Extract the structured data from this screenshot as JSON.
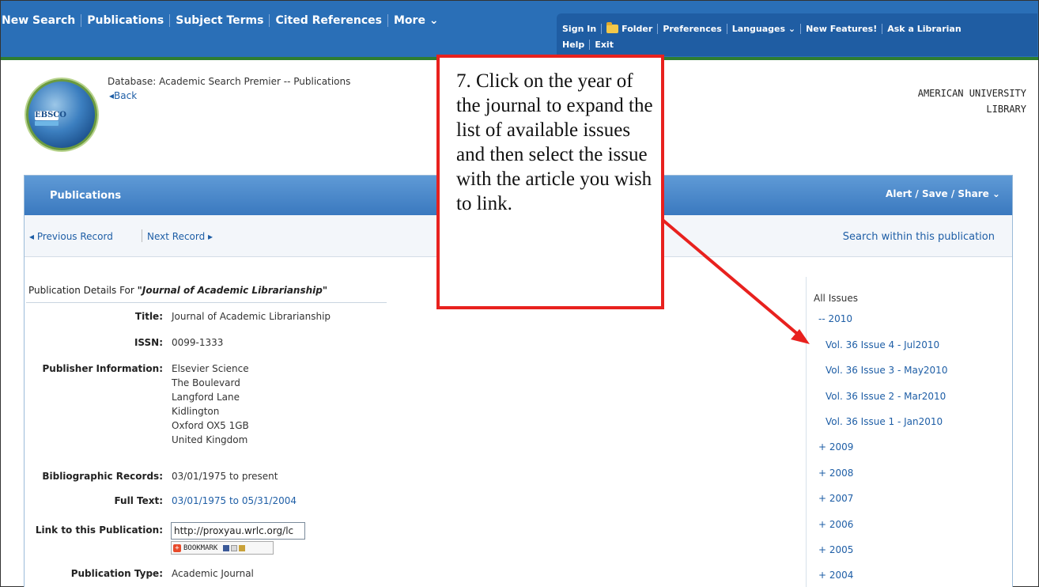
{
  "topnav": {
    "left_items": [
      "New Search",
      "Publications",
      "Subject Terms",
      "Cited References",
      "More ⌄"
    ],
    "right_row1": [
      "Sign In",
      "Folder",
      "Preferences",
      "Languages ⌄",
      "New Features!",
      "Ask a Librarian"
    ],
    "right_row2": [
      "Help",
      "Exit"
    ]
  },
  "header": {
    "logo_text": "EBSCO",
    "database_label": "Database: Academic Search Premier -- Publications",
    "back_link": "◂Back",
    "institution_line1": "AMERICAN UNIVERSITY",
    "institution_line2": "LIBRARY"
  },
  "panel": {
    "title": "Publications",
    "share": "Alert / Save / Share ⌄",
    "prev": "◂ Previous Record",
    "next": "Next Record ▸",
    "search_within": "Search within this publication"
  },
  "details": {
    "heading_prefix": "Publication Details For ",
    "heading_title": "\"Journal of Academic Librarianship\"",
    "title_label": "Title:",
    "title_value": "Journal of Academic Librarianship",
    "issn_label": "ISSN:",
    "issn_value": "0099-1333",
    "publisher_label": "Publisher Information:",
    "publisher_lines": [
      "Elsevier Science",
      "The Boulevard",
      "Langford Lane",
      "Kidlington",
      "Oxford OX5 1GB",
      "United Kingdom"
    ],
    "biblio_label": "Bibliographic Records:",
    "biblio_value": "03/01/1975 to present",
    "fulltext_label": "Full Text:",
    "fulltext_value": "03/01/1975 to 05/31/2004",
    "link_label": "Link to this Publication:",
    "link_value": "http://proxyau.wrlc.org/lc",
    "bookmark_label": "BOOKMARK",
    "type_label": "Publication Type:",
    "type_value": "Academic Journal"
  },
  "issues": {
    "all_label": "All Issues",
    "expanded_year": "-- 2010",
    "issues_2010": [
      "Vol. 36 Issue 4 - Jul2010",
      "Vol. 36 Issue 3 - May2010",
      "Vol. 36 Issue 2 - Mar2010",
      "Vol. 36 Issue 1 - Jan2010"
    ],
    "collapsed_years": [
      "+ 2009",
      "+ 2008",
      "+ 2007",
      "+ 2006",
      "+ 2005",
      "+ 2004"
    ]
  },
  "callout": {
    "text": "7. Click on the year of the journal to expand the list of available issues and then select the issue with the article you wish to link.",
    "border_color": "#e8211e"
  }
}
